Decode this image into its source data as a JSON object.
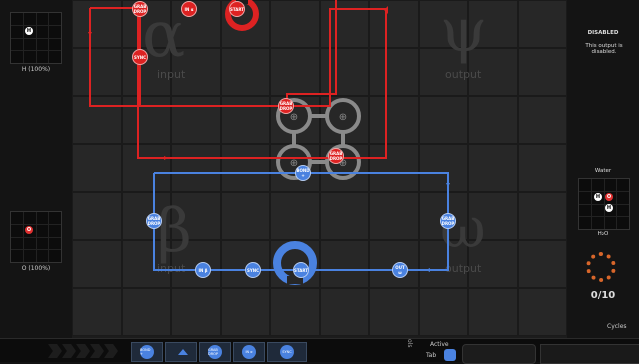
{
  "inputs": {
    "alpha": {
      "symbol": "α",
      "label": "input"
    },
    "beta": {
      "symbol": "β",
      "label": "input"
    }
  },
  "outputs": {
    "psi": {
      "symbol": "ψ",
      "label": "output"
    },
    "omega": {
      "symbol": "ω",
      "label": "output"
    }
  },
  "left_panel": {
    "alpha_molecule": {
      "atom": "H",
      "label": "H (100%)"
    },
    "beta_molecule": {
      "atom": "O",
      "label": "O (100%)"
    }
  },
  "right_panel": {
    "status_title": "DISABLED",
    "status_text": "This output is disabled.",
    "target_title": "Water",
    "target_atoms": [
      "H",
      "O",
      "H"
    ],
    "target_formula": "H₂O",
    "progress": "0/10",
    "progress_value": 0,
    "progress_total": 10
  },
  "red_waldo": {
    "color": "#d22222",
    "instructions": [
      "GRAB DROP",
      "IN α",
      "START",
      "SYNC",
      "GRAB DROP",
      "GRAB DROP"
    ]
  },
  "blue_waldo": {
    "color": "#4a82e0",
    "instructions": [
      "BOND +",
      "GRAB DROP",
      "GRAB DROP",
      "IN β",
      "SYNC",
      "START",
      "OUT ω"
    ]
  },
  "bottom_bar": {
    "tools_label": "ols",
    "active_label": "Active",
    "tab_label": "Tab",
    "cycles_label": "Cycles",
    "palette": [
      "BOND +",
      "",
      "GRAB DROP",
      "IN α",
      "SYNC"
    ]
  }
}
